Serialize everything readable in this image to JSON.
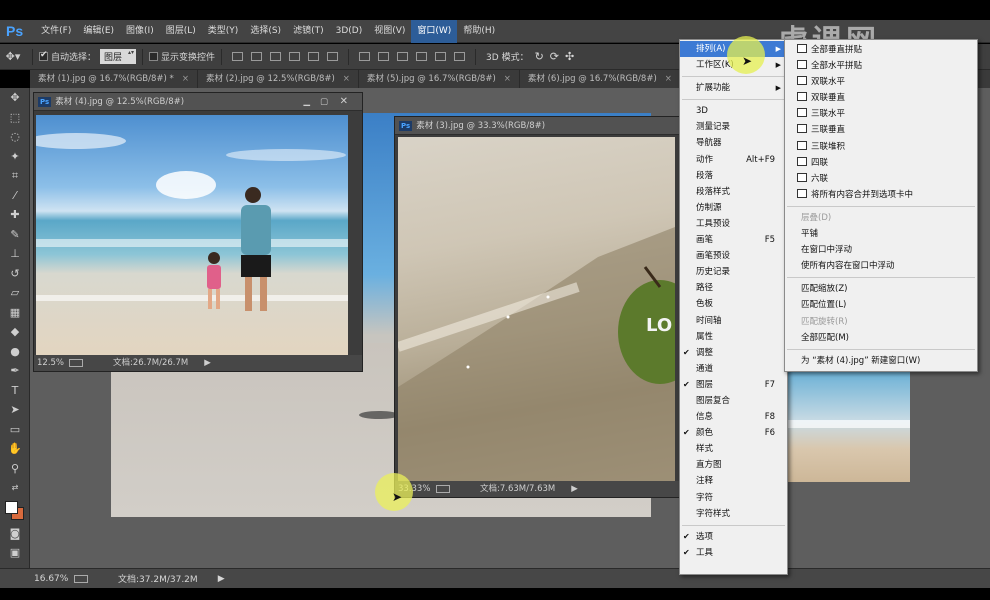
{
  "app": {
    "logo": "Ps"
  },
  "menubar": [
    "文件(F)",
    "编辑(E)",
    "图像(I)",
    "图层(L)",
    "类型(Y)",
    "选择(S)",
    "滤镜(T)",
    "3D(D)",
    "视图(V)",
    "窗口(W)",
    "帮助(H)"
  ],
  "options": {
    "auto_select_label": "自动选择：",
    "auto_select_value": "图层",
    "show_transform_label": "显示变换控件",
    "mode_3d_label": "3D 模式："
  },
  "tabs": [
    "素材 (1).jpg @ 16.7%(RGB/8#) *",
    "素材 (2).jpg @ 12.5%(RGB/8#)",
    "素材 (5).jpg @ 16.7%(RGB/8#)",
    "素材 (6).jpg @ 16.7%(RGB/8#)"
  ],
  "window1": {
    "title": "素材 (4).jpg @ 12.5%(RGB/8#)",
    "zoom": "12.5%",
    "doc": "文档:26.7M/26.7M"
  },
  "window2": {
    "title": "素材 (3).jpg @ 33.3%(RGB/8#)",
    "zoom": "33.33%",
    "doc": "文档:7.63M/7.63M",
    "overlay_text": "LO"
  },
  "status": {
    "zoom": "16.67%",
    "doc": "文档:37.2M/37.2M"
  },
  "watermark": "虎课网",
  "window_menu": {
    "items": [
      {
        "label": "排列(A)",
        "arrow": true,
        "highlight": true
      },
      {
        "label": "工作区(K)",
        "arrow": true
      },
      {
        "sep": true
      },
      {
        "label": "扩展功能",
        "arrow": true
      },
      {
        "sep": true
      },
      {
        "label": "3D"
      },
      {
        "label": "测量记录"
      },
      {
        "label": "导航器"
      },
      {
        "label": "动作",
        "shortcut": "Alt+F9"
      },
      {
        "label": "段落"
      },
      {
        "label": "段落样式"
      },
      {
        "label": "仿制源"
      },
      {
        "label": "工具预设"
      },
      {
        "label": "画笔",
        "shortcut": "F5"
      },
      {
        "label": "画笔预设"
      },
      {
        "label": "历史记录"
      },
      {
        "label": "路径"
      },
      {
        "label": "色板"
      },
      {
        "label": "时间轴"
      },
      {
        "label": "属性"
      },
      {
        "label": "调整",
        "checked": true
      },
      {
        "label": "通道"
      },
      {
        "label": "图层",
        "shortcut": "F7",
        "checked": true
      },
      {
        "label": "图层复合"
      },
      {
        "label": "信息",
        "shortcut": "F8"
      },
      {
        "label": "颜色",
        "shortcut": "F6",
        "checked": true
      },
      {
        "label": "样式"
      },
      {
        "label": "直方图"
      },
      {
        "label": "注释"
      },
      {
        "label": "字符"
      },
      {
        "label": "字符样式"
      },
      {
        "sep": true
      },
      {
        "label": "选项",
        "checked": true
      },
      {
        "label": "工具",
        "checked": true
      }
    ]
  },
  "arrange_menu": {
    "items": [
      {
        "label": "全部垂直拼贴",
        "icon": true
      },
      {
        "label": "全部水平拼贴",
        "icon": true
      },
      {
        "label": "双联水平",
        "icon": true
      },
      {
        "label": "双联垂直",
        "icon": true
      },
      {
        "label": "三联水平",
        "icon": true
      },
      {
        "label": "三联垂直",
        "icon": true
      },
      {
        "label": "三联堆积",
        "icon": true
      },
      {
        "label": "四联",
        "icon": true
      },
      {
        "label": "六联",
        "icon": true
      },
      {
        "label": "将所有内容合并到选项卡中",
        "icon": true
      },
      {
        "sep": true
      },
      {
        "label": "层叠(D)",
        "disabled": true
      },
      {
        "label": "平铺"
      },
      {
        "label": "在窗口中浮动"
      },
      {
        "label": "使所有内容在窗口中浮动"
      },
      {
        "sep": true
      },
      {
        "label": "匹配缩放(Z)"
      },
      {
        "label": "匹配位置(L)"
      },
      {
        "label": "匹配旋转(R)",
        "disabled": true
      },
      {
        "label": "全部匹配(M)"
      },
      {
        "sep": true
      },
      {
        "label": "为 “素材 (4).jpg” 新建窗口(W)"
      }
    ]
  }
}
